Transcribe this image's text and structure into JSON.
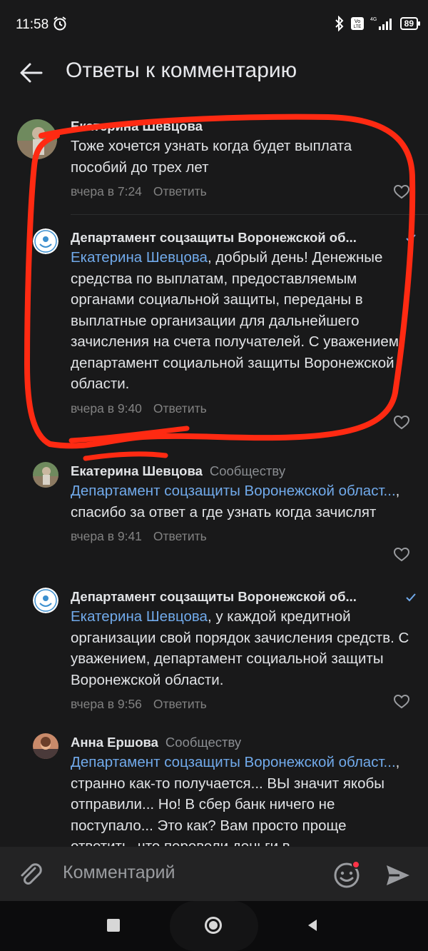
{
  "status_bar": {
    "time": "11:58",
    "battery": "89",
    "network_top": "4G",
    "volte": "Vo LTE"
  },
  "header": {
    "title": "Ответы к комментарию"
  },
  "comments": [
    {
      "author": "Екатерина Шевцова",
      "text": "Тоже хочется узнать когда будет выплата пособий до трех лет",
      "time": "вчера в 7:24",
      "reply": "Ответить"
    },
    {
      "author": "Департамент соцзащиты Воронежской об...",
      "mention": "Екатерина Шевцова",
      "text": ", добрый день! Денежные средства по выплатам, предоставляемым органами социальной защиты, переданы в выплатные организации для дальнейшего зачисления на счета получателей. С уважением, департамент социальной защиты Воронежской области.",
      "time": "вчера в 9:40",
      "reply": "Ответить"
    },
    {
      "author": "Екатерина Шевцова",
      "target": "Сообществу",
      "mention": "Департамент соцзащиты Воронежской област...",
      "text": ", спасибо за ответ а где узнать когда зачислят",
      "time": "вчера в 9:41",
      "reply": "Ответить"
    },
    {
      "author": "Департамент соцзащиты Воронежской об...",
      "mention": "Екатерина Шевцова",
      "text": ", у каждой кредитной организации свой порядок зачисления средств. С уважением, департамент социальной защиты Воронежской области.",
      "time": "вчера в 9:56",
      "reply": "Ответить"
    },
    {
      "author": "Анна Ершова",
      "target": "Сообществу",
      "mention": "Департамент соцзащиты Воронежской област...",
      "text": ", странно как-то получается... ВЫ значит якобы отправили... Но!  В сбер банк ничего не поступало... Это как?  Вам просто проще ответить, что перевели деньги в",
      "time": "",
      "reply": ""
    }
  ],
  "composer": {
    "placeholder": "Комментарий"
  },
  "colors": {
    "background": "#19191a",
    "mention": "#71aaeb",
    "annotation": "#ff2a12"
  }
}
